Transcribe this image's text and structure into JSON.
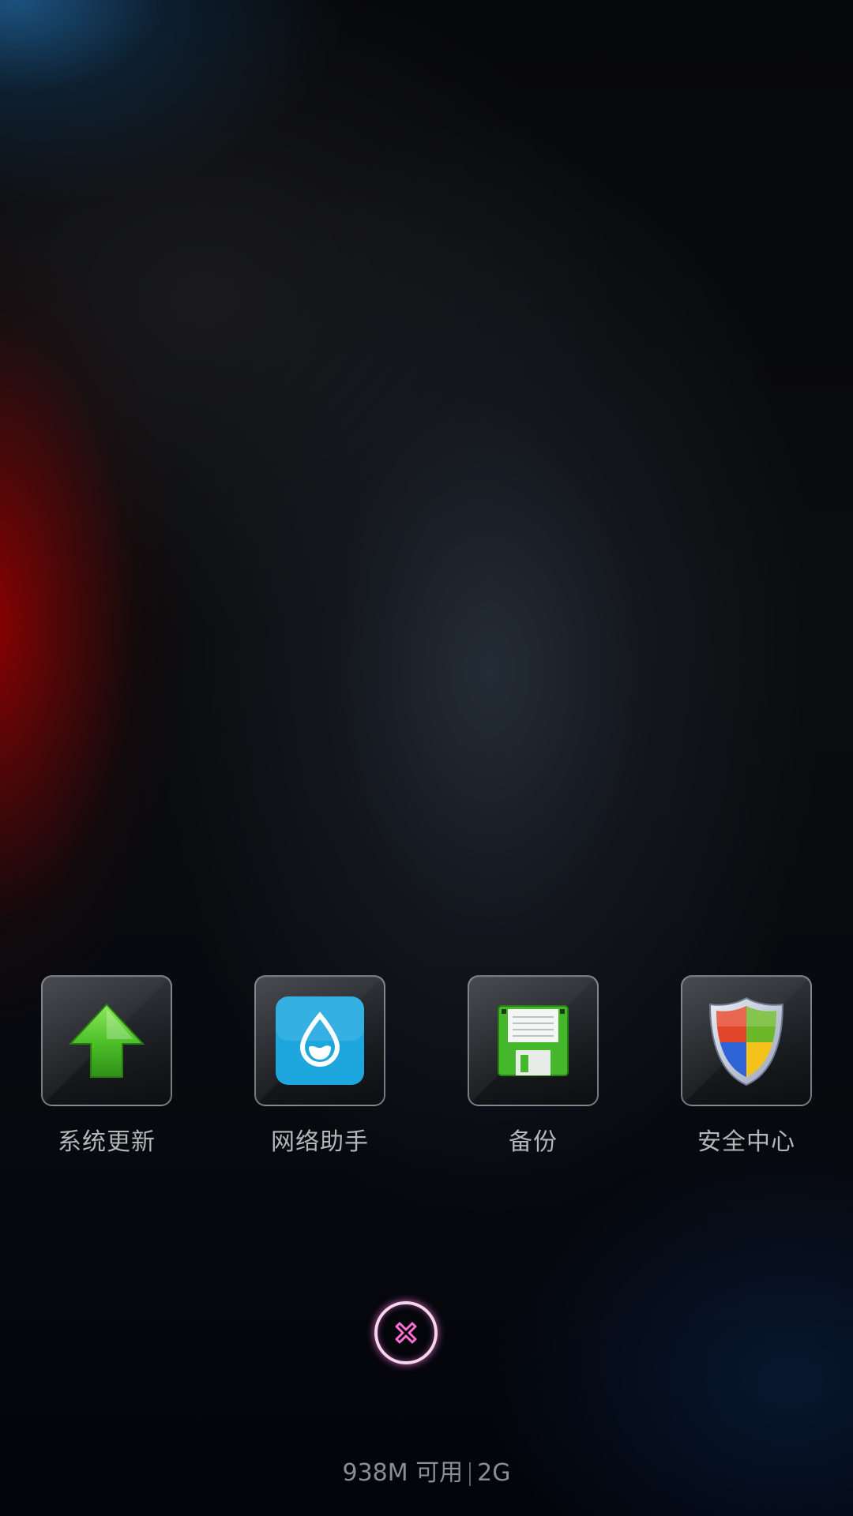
{
  "tiles": [
    {
      "label": "系统更新",
      "icon": "green-up-arrow-icon"
    },
    {
      "label": "网络助手",
      "icon": "water-drop-icon"
    },
    {
      "label": "备份",
      "icon": "floppy-disk-icon"
    },
    {
      "label": "安全中心",
      "icon": "shield-icon"
    }
  ],
  "close_button": {
    "icon": "close-icon"
  },
  "status": {
    "memory": "938M 可用",
    "network": "2G"
  },
  "colors": {
    "label_text": "#b4b6ba",
    "close_ring": "#f6d6ee",
    "close_glow": "#ff78dc",
    "drop_tile": "#1ea7df",
    "arrow_green": "#4fc22a",
    "floppy_green": "#44b82a"
  }
}
